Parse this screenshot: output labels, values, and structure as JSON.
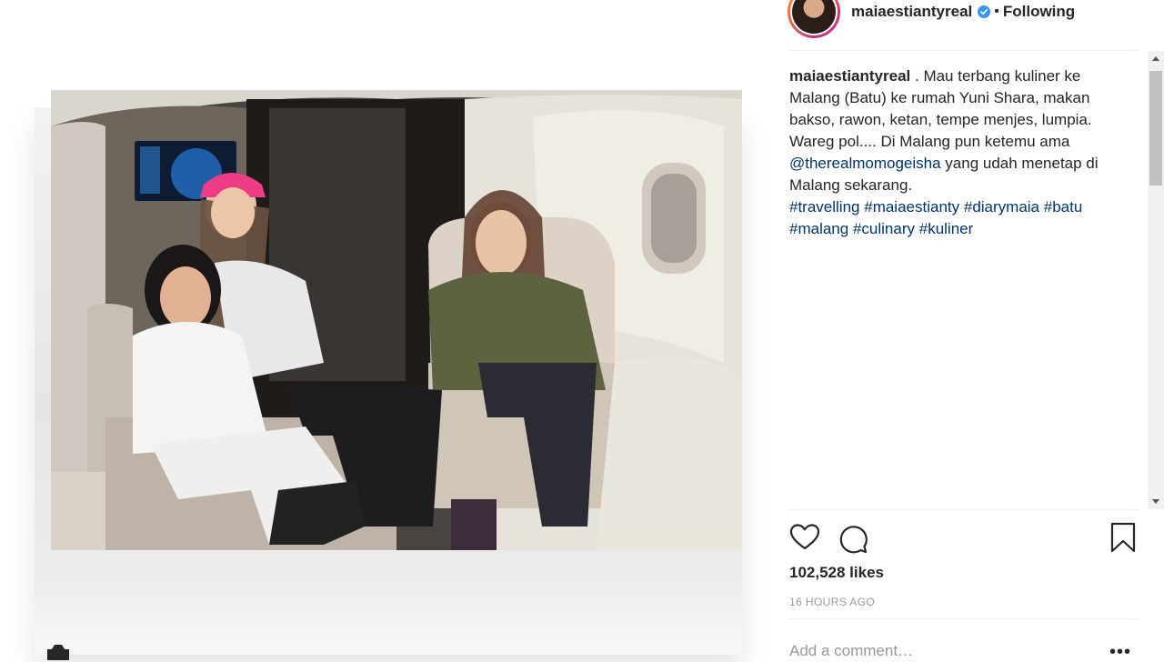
{
  "post": {
    "username": "maiaestiantyreal",
    "separator": "•",
    "follow_label": "Following",
    "caption": {
      "user": "maiaestiantyreal",
      "after_user": " .",
      "text1": "Mau terbang kuliner ke Malang (Batu) ke rumah Yuni Shara, makan bakso, rawon, ketan, tempe menjes, lumpia. Wareg pol.... Di Malang pun ketemu ama ",
      "mention": "@therealmomogeisha",
      "text2": " yang udah menetap di Malang sekarang.",
      "hashtags": [
        "#travelling",
        "#maiaestianty",
        "#diarymaia",
        "#batu",
        "#malang",
        "#culinary",
        "#kuliner"
      ]
    },
    "likes": "102,528 likes",
    "timestamp": "16 HOURS AGO",
    "comment_placeholder": "Add a comment…",
    "more_label": "•••"
  },
  "icons": {
    "verified": "verified-badge-icon",
    "heart": "heart-icon",
    "comment": "comment-icon",
    "bookmark": "bookmark-icon",
    "corner": "camera-icon"
  },
  "colors": {
    "link": "#003569",
    "verified": "#3897f0",
    "meta": "#999999",
    "text": "#262626"
  }
}
